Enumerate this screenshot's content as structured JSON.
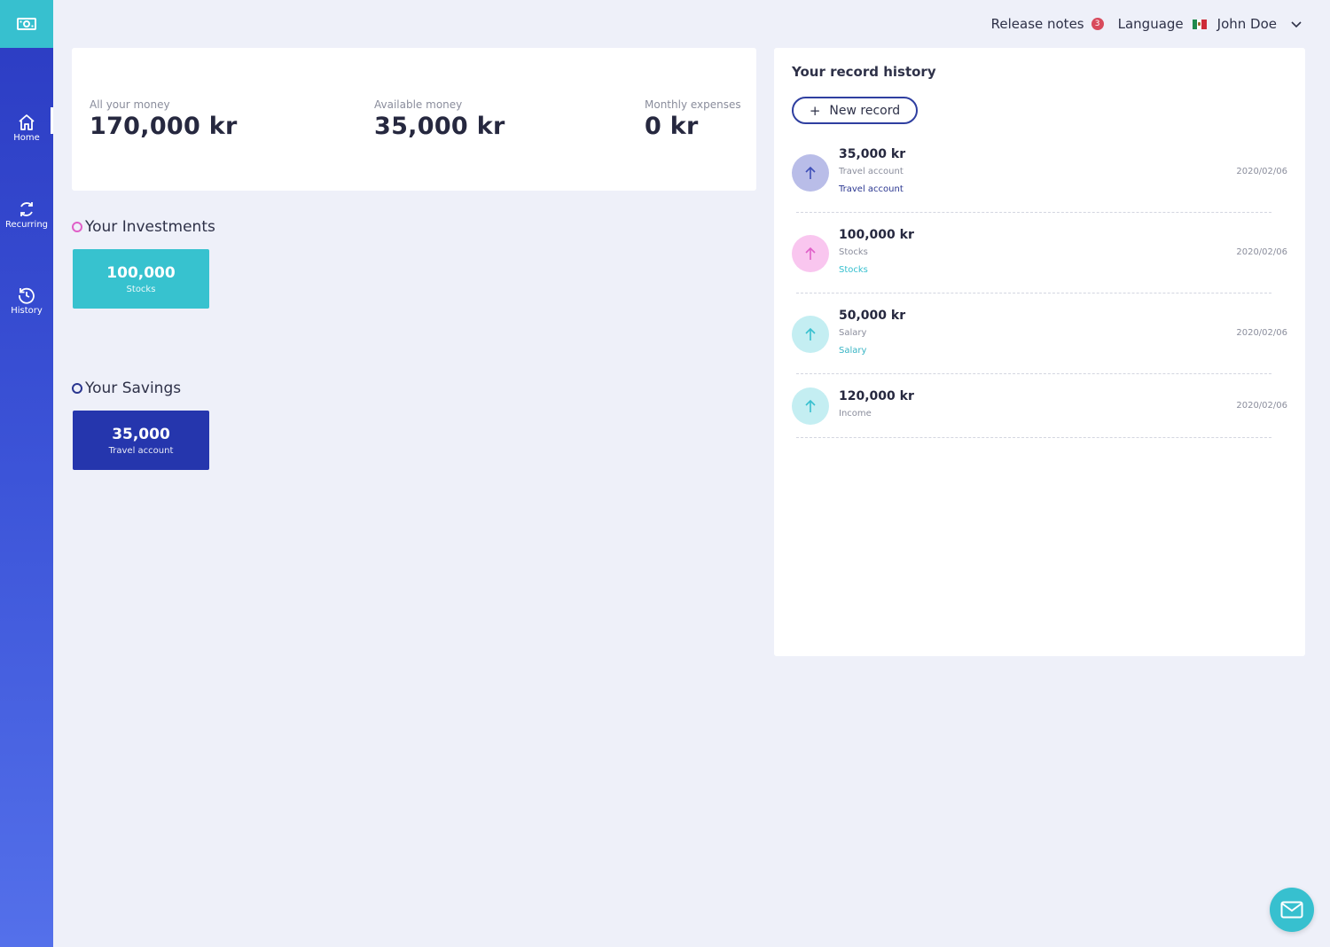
{
  "sidebar": {
    "logo_icon": "money-icon",
    "items": [
      {
        "label": "Home",
        "icon": "home-icon",
        "active": true
      },
      {
        "label": "Recurring",
        "icon": "recurring-icon",
        "active": false
      },
      {
        "label": "History",
        "icon": "history-icon",
        "active": false
      }
    ]
  },
  "topbar": {
    "release_notes": "Release notes",
    "release_badge": "3",
    "language": "Language",
    "flag": "mexico-flag",
    "user_name": "John Doe"
  },
  "summary": {
    "all_money_label": "All your money",
    "all_money_value": "170,000 kr",
    "available_label": "Available money",
    "available_value": "35,000 kr",
    "expenses_label": "Monthly expenses",
    "expenses_value": "0 kr"
  },
  "investments": {
    "title": "Your Investments",
    "ring_color": "#e05fc8",
    "tiles": [
      {
        "amount": "100,000",
        "label": "Stocks",
        "color": "#37c2cf"
      }
    ]
  },
  "savings": {
    "title": "Your Savings",
    "ring_color": "#2a3690",
    "tiles": [
      {
        "amount": "35,000",
        "label": "Travel account",
        "color": "#2536ad"
      }
    ]
  },
  "history": {
    "title": "Your record history",
    "new_record_label": "New record",
    "records": [
      {
        "amount": "35,000 kr",
        "desc": "Travel account",
        "tag": "Travel account",
        "tag_color": "#2a3690",
        "date": "2020/02/06",
        "circle_bg": "#b9bde8",
        "arrow_color": "#3f4fb8"
      },
      {
        "amount": "100,000 kr",
        "desc": "Stocks",
        "tag": "Stocks",
        "tag_color": "#37c0cf",
        "date": "2020/02/06",
        "circle_bg": "#f9c6ef",
        "arrow_color": "#e05fc8"
      },
      {
        "amount": "50,000 kr",
        "desc": "Salary",
        "tag": "Salary",
        "tag_color": "#37b4c4",
        "date": "2020/02/06",
        "circle_bg": "#c4eef2",
        "arrow_color": "#37c0cf"
      },
      {
        "amount": "120,000 kr",
        "desc": "Income",
        "tag": "",
        "tag_color": "#37b4c4",
        "date": "2020/02/06",
        "circle_bg": "#c4eef2",
        "arrow_color": "#37c0cf"
      }
    ]
  },
  "fab_icon": "mail-icon"
}
